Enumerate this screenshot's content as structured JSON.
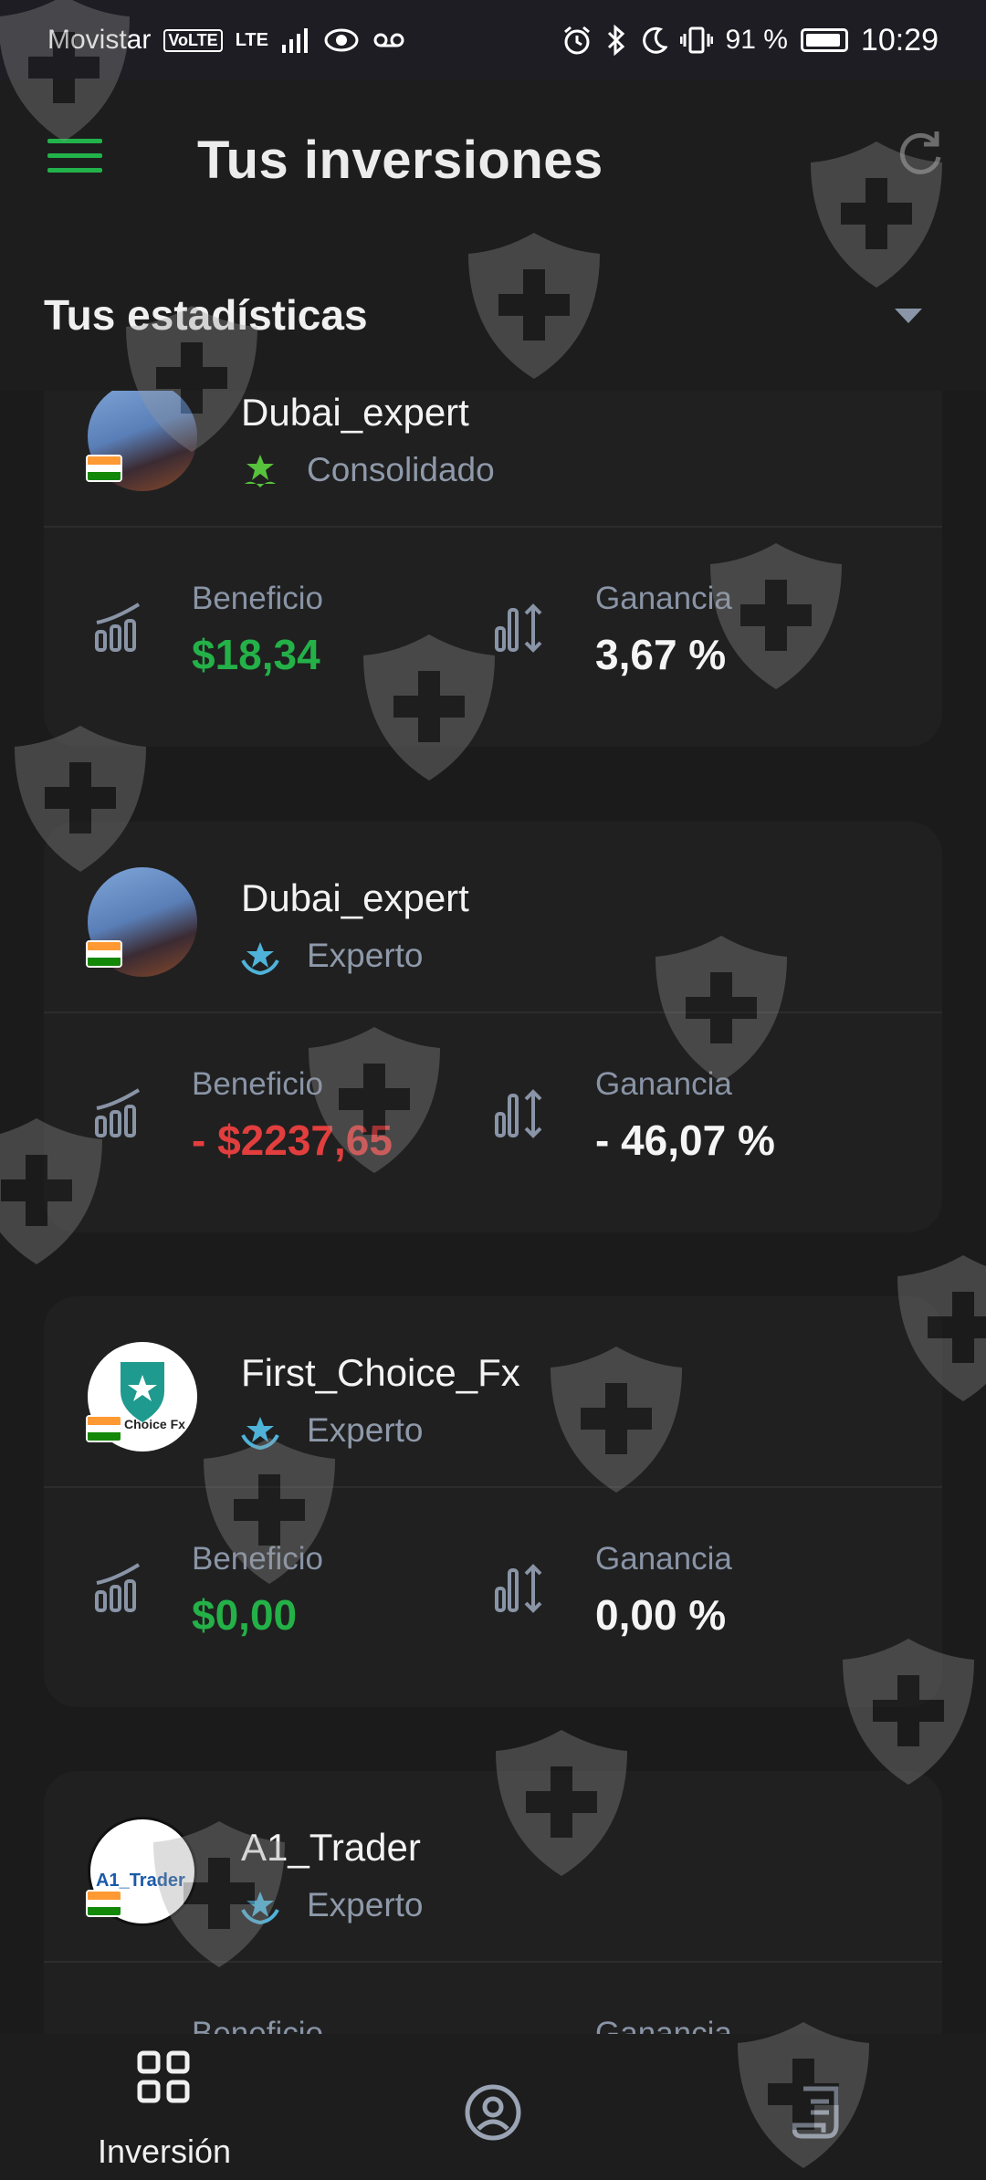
{
  "status_bar": {
    "carrier": "Movistar",
    "volte": "VoLTE",
    "network": "LTE",
    "battery_percent": "91 %",
    "time": "10:29"
  },
  "app_bar": {
    "title": "Tus inversiones"
  },
  "stats": {
    "title": "Tus estadísticas"
  },
  "cards": [
    {
      "name": "Dubai_expert",
      "rank": "Consolidado",
      "benefit_label": "Beneficio",
      "benefit": "$18,34",
      "gain_label": "Ganancia",
      "gain": "3,67 %"
    },
    {
      "name": "Dubai_expert",
      "rank": "Experto",
      "benefit_label": "Beneficio",
      "benefit": "- $2237,65",
      "gain_label": "Ganancia",
      "gain": "- 46,07 %"
    },
    {
      "name": "First_Choice_Fx",
      "rank": "Experto",
      "benefit_label": "Beneficio",
      "benefit": "$0,00",
      "gain_label": "Ganancia",
      "gain": "0,00 %",
      "avatar_text": "Choice Fx"
    },
    {
      "name": "A1_Trader",
      "rank": "Experto",
      "benefit_label": "Beneficio",
      "benefit": "",
      "gain_label": "Ganancia",
      "gain": "",
      "avatar_text": "A1_Trader"
    }
  ],
  "bottom_nav": [
    {
      "label": "Inversión",
      "icon": "grid-icon"
    },
    {
      "label": "",
      "icon": "profile-icon"
    },
    {
      "label": "",
      "icon": "document-icon"
    }
  ],
  "colors": {
    "accent": "#22b24c",
    "negative": "#e23e3e",
    "muted": "#8994a6"
  }
}
